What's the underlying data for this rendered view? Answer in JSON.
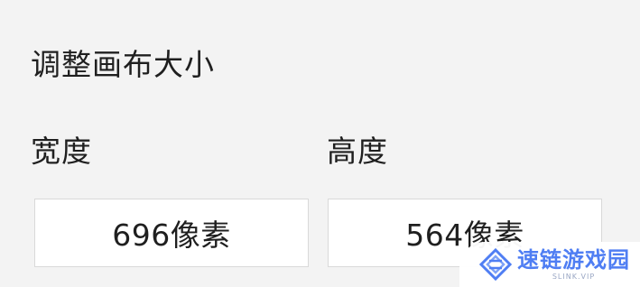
{
  "panel": {
    "title": "调整画布大小",
    "width": {
      "label": "宽度",
      "value": "696像素"
    },
    "height": {
      "label": "高度",
      "value": "564像素"
    }
  },
  "watermark": {
    "name": "速链游戏园",
    "sub": "SLINK.VIP",
    "icon": "diamond-logo-icon",
    "color": "#4f7ef3"
  }
}
